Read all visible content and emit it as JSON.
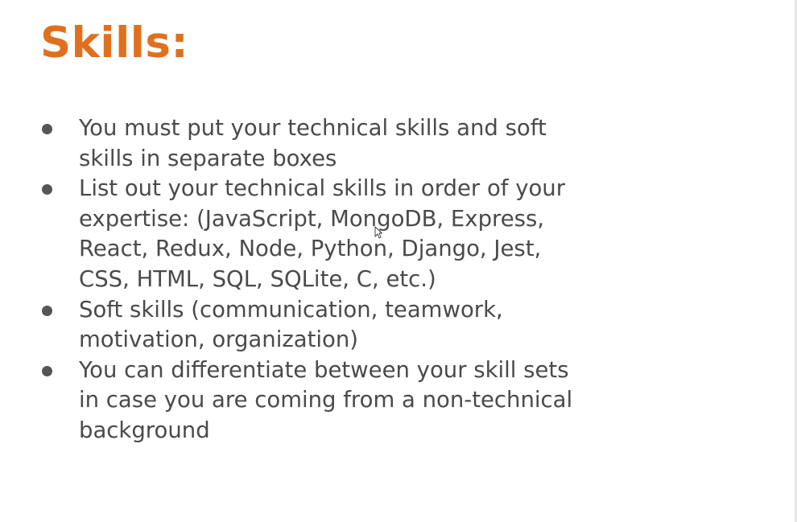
{
  "slide": {
    "title": "Skills:",
    "bullets": [
      "You must put your technical skills and soft skills in separate boxes",
      "List out your technical skills in order of your expertise: (JavaScript, MongoDB, Express, React, Redux, Node, Python, Django, Jest, CSS, HTML, SQL, SQLite, C, etc.)",
      "Soft skills (communication, teamwork, motivation, organization)",
      "You can differentiate between your skill sets in case you are coming from a non-technical background"
    ]
  },
  "colors": {
    "title": "#e0701d",
    "body_text": "#4a4a4a",
    "bullet": "#555555",
    "background": "#ffffff"
  },
  "icons": {
    "cursor": "mouse-pointer-icon"
  }
}
